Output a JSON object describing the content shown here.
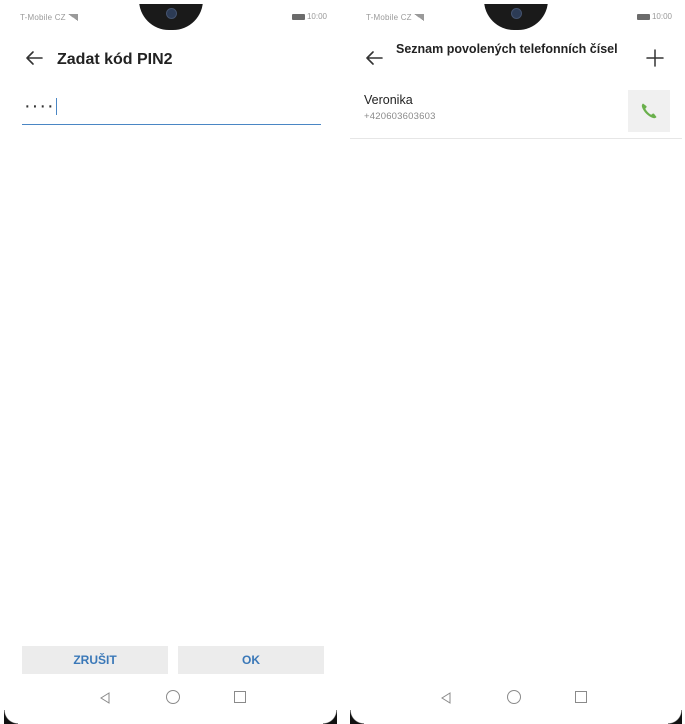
{
  "left": {
    "status": {
      "carrier": "T-Mobile CZ",
      "time": "10:00"
    },
    "header": {
      "title": "Zadat kód PIN2"
    },
    "pin_input": {
      "value": "····"
    },
    "buttons": {
      "cancel_label": "ZRUŠIT",
      "ok_label": "OK"
    }
  },
  "right": {
    "status": {
      "carrier": "T-Mobile CZ",
      "time": "10:00"
    },
    "header": {
      "title": "Seznam povolených telefonních čísel"
    },
    "contacts": [
      {
        "name": "Veronika",
        "number": "+420603603603"
      }
    ]
  },
  "colors": {
    "accent": "#3a78b8",
    "call_green": "#6ab04c",
    "button_bg": "#ececec"
  },
  "icons": [
    "back-arrow-icon",
    "plus-icon",
    "phone-icon",
    "nav-back-icon",
    "nav-home-icon",
    "nav-recent-icon",
    "battery-icon",
    "signal-icon"
  ]
}
